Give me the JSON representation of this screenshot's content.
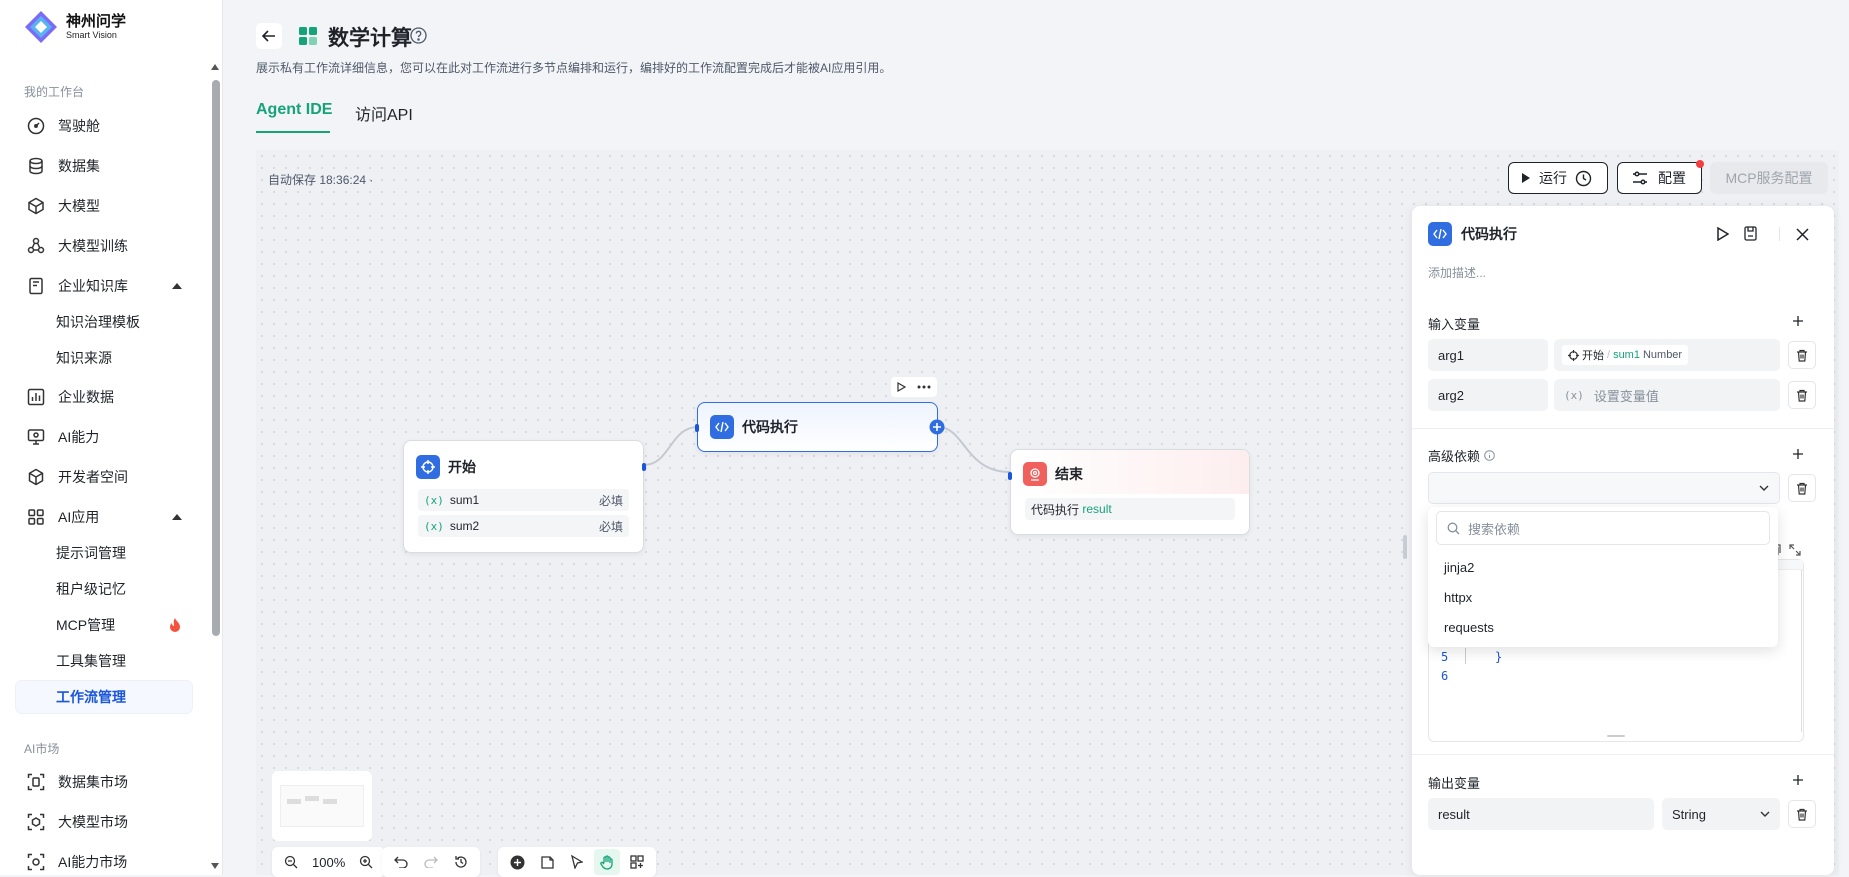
{
  "brand": {
    "name_cn": "神州问学",
    "name_en": "Smart Vision"
  },
  "sidebar": {
    "section1": "我的工作台",
    "items": [
      {
        "label": "驾驶舱"
      },
      {
        "label": "数据集"
      },
      {
        "label": "大模型"
      },
      {
        "label": "大模型训练"
      },
      {
        "label": "企业知识库"
      },
      {
        "label": "知识治理模板"
      },
      {
        "label": "知识来源"
      },
      {
        "label": "企业数据"
      },
      {
        "label": "AI能力"
      },
      {
        "label": "开发者空间"
      },
      {
        "label": "AI应用"
      },
      {
        "label": "提示词管理"
      },
      {
        "label": "租户级记忆"
      },
      {
        "label": "MCP管理"
      },
      {
        "label": "工具集管理"
      },
      {
        "label": "工作流管理"
      }
    ],
    "section2": "AI市场",
    "market": [
      {
        "label": "数据集市场"
      },
      {
        "label": "大模型市场"
      },
      {
        "label": "AI能力市场"
      }
    ]
  },
  "header": {
    "title": "数学计算",
    "description": "展示私有工作流详细信息，您可以在此对工作流进行多节点编排和运行，编排好的工作流配置完成后才能被AI应用引用。",
    "tabs": [
      {
        "label": "Agent IDE"
      },
      {
        "label": "访问API"
      }
    ]
  },
  "canvas": {
    "autosave": "自动保存 18:36:24 ·",
    "run_label": "运行",
    "config_label": "配置",
    "mcp_label": "MCP服务配置",
    "zoom": "100%"
  },
  "nodes": {
    "start": {
      "title": "开始",
      "vars": [
        {
          "name": "sum1",
          "req": "必填"
        },
        {
          "name": "sum2",
          "req": "必填"
        }
      ]
    },
    "code": {
      "title": "代码执行"
    },
    "end": {
      "title": "结束",
      "ref_node": "代码执行",
      "ref_var": "result"
    }
  },
  "panel": {
    "title": "代码执行",
    "description": "添加描述...",
    "input_section": "输入变量",
    "inputs": [
      {
        "name": "arg1",
        "source_node": "开始",
        "sep": "/",
        "source_var": "sum1",
        "type": "Number"
      },
      {
        "name": "arg2",
        "placeholder": "设置变量值"
      }
    ],
    "deps_section": "高级依赖",
    "deps_search_placeholder": "搜索依赖",
    "deps_options": [
      "jinja2",
      "httpx",
      "requests"
    ],
    "code_lines": [
      {
        "n": "5",
        "code": "}"
      },
      {
        "n": "6",
        "code": ""
      }
    ],
    "output_section": "输出变量",
    "outputs": [
      {
        "name": "result",
        "type": "String"
      }
    ]
  },
  "colors": {
    "accent": "#16a37a",
    "primary": "#1a56db",
    "danger": "#f53f3f"
  }
}
